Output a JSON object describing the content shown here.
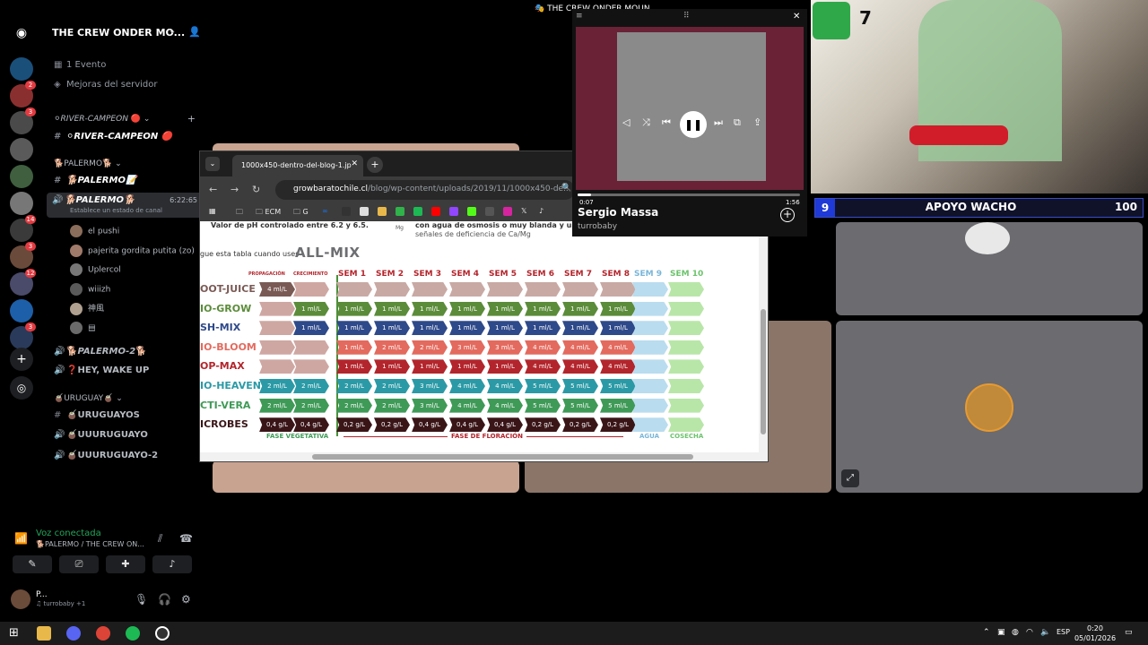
{
  "discord": {
    "server_name": "THE CREW ONDER MO...",
    "rail_badges": [
      "2",
      "3",
      "14",
      "3",
      "12",
      "3"
    ],
    "items": {
      "event": "1 Evento",
      "boosts": "Mejoras del servidor",
      "cat_river": "RIVER-CAMPEON",
      "chan_river": "RIVER-CAMPEON",
      "cat_palermo": "PALERMO",
      "chan_palermo": "PALERMO",
      "vc_palermo": "PALERMO",
      "vc_time": "6:22:65",
      "vc_status": "Establece un estado de canal",
      "vc_palermo2": "PALERMO-2",
      "vc_heywake": "HEY, WAKE UP",
      "cat_uruguay": "URUGUAY",
      "chan_uruguayos": "URUGUAYOS",
      "vc_uuruguayo": "UUURUGUAYO",
      "vc_uuruguayo2": "UUURUGUAYO-2"
    },
    "members": [
      "el pushi",
      "pajerita gordita putita (zo)",
      "Uplercol",
      "wiiizh",
      "神風",
      "▤"
    ],
    "voice_panel": {
      "status": "Voz conectada",
      "sub": "PALERMO / THE CREW ON...",
      "user_name": "P...",
      "user_status": "turrobaby +1"
    }
  },
  "browser": {
    "tab_title": "1000x450-dentro-del-blog-1.jp",
    "url_host": "growbaratochile.cl",
    "url_path": "/blog/wp-content/uploads/2019/11/1000x450-de...",
    "bookmarks": [
      "ECM",
      "G"
    ],
    "page_text": {
      "ph_line": "Valor de pH controlado entre 6.2 y 6.5.",
      "water_line": "con agua de osmosis o muy blanda y una vez",
      "water_line2": "señales de deficiencia de Ca/Mg",
      "mg_label": "Mg",
      "lead": "gue esta tabla cuando uses",
      "brand": "ALL-MIX"
    },
    "table": {
      "col_prop": "PROPAGACIÓN",
      "col_grow": "CRECIMIENTO",
      "weeks": [
        "SEM 1",
        "SEM 2",
        "SEM 3",
        "SEM 4",
        "SEM 5",
        "SEM 6",
        "SEM 7",
        "SEM 8",
        "SEM 9",
        "SEM 10"
      ],
      "products": [
        {
          "name": "OOT-JUICE",
          "color": "#7a5a55",
          "cells": [
            "4 ml/L",
            "",
            "",
            "",
            "",
            "",
            "",
            "",
            "",
            "",
            "",
            ""
          ]
        },
        {
          "name": "IO-GROW",
          "color": "#5b8c3a",
          "cells": [
            "",
            "1 ml/L",
            "1 ml/L",
            "1 ml/L",
            "1 ml/L",
            "1 ml/L",
            "1 ml/L",
            "1 ml/L",
            "1 ml/L",
            "1 ml/L",
            "",
            ""
          ]
        },
        {
          "name": "SH-MIX",
          "color": "#2f4a8a",
          "cells": [
            "",
            "1 ml/L",
            "1 ml/L",
            "1 ml/L",
            "1 ml/L",
            "1 ml/L",
            "1 ml/L",
            "1 ml/L",
            "1 ml/L",
            "1 ml/L",
            "",
            ""
          ]
        },
        {
          "name": "IO-BLOOM",
          "color": "#e36a5e",
          "cells": [
            "",
            "",
            "1 ml/L",
            "2 ml/L",
            "2 ml/L",
            "3 ml/L",
            "3 ml/L",
            "4 ml/L",
            "4 ml/L",
            "4 ml/L",
            "",
            ""
          ]
        },
        {
          "name": "OP-MAX",
          "color": "#b3252c",
          "cells": [
            "",
            "",
            "1 ml/L",
            "1 ml/L",
            "1 ml/L",
            "1 ml/L",
            "1 ml/L",
            "4 ml/L",
            "4 ml/L",
            "4 ml/L",
            "",
            ""
          ]
        },
        {
          "name": "IO-HEAVEN",
          "color": "#2b9aa6",
          "cells": [
            "2 ml/L",
            "2 ml/L",
            "2 ml/L",
            "2 ml/L",
            "3 ml/L",
            "4 ml/L",
            "4 ml/L",
            "5 ml/L",
            "5 ml/L",
            "5 ml/L",
            "",
            ""
          ]
        },
        {
          "name": "CTI-VERA",
          "color": "#3f9a57",
          "cells": [
            "2 ml/L",
            "2 ml/L",
            "2 ml/L",
            "2 ml/L",
            "3 ml/L",
            "4 ml/L",
            "4 ml/L",
            "5 ml/L",
            "5 ml/L",
            "5 ml/L",
            "",
            ""
          ]
        },
        {
          "name": "ICROBES",
          "color": "#3a1518",
          "cells": [
            "0,4 g/L",
            "0,4 g/L",
            "0,2 g/L",
            "0,2 g/L",
            "0,4 g/L",
            "0,4 g/L",
            "0,4 g/L",
            "0,2 g/L",
            "0,2 g/L",
            "0,2 g/L",
            "",
            ""
          ]
        }
      ],
      "phase_veg": "FASE VEGETATIVA",
      "phase_flower": "FASE DE FLORACIÓN",
      "phase_water": "AGUA",
      "phase_harvest": "COSECHA"
    }
  },
  "player": {
    "window_title": "THE CREW ONDER MOUN",
    "elapsed": "0:07",
    "duration": "1:56",
    "progress_fraction": 0.06,
    "track": "Sergio Massa",
    "artist": "turrobaby"
  },
  "overlay": {
    "left_num": "9",
    "label": "APOYO WACHO",
    "right_num": "100",
    "cam_number": "7"
  },
  "taskbar": {
    "lang": "ESP",
    "time": "0:20",
    "date": "05/01/2026"
  }
}
